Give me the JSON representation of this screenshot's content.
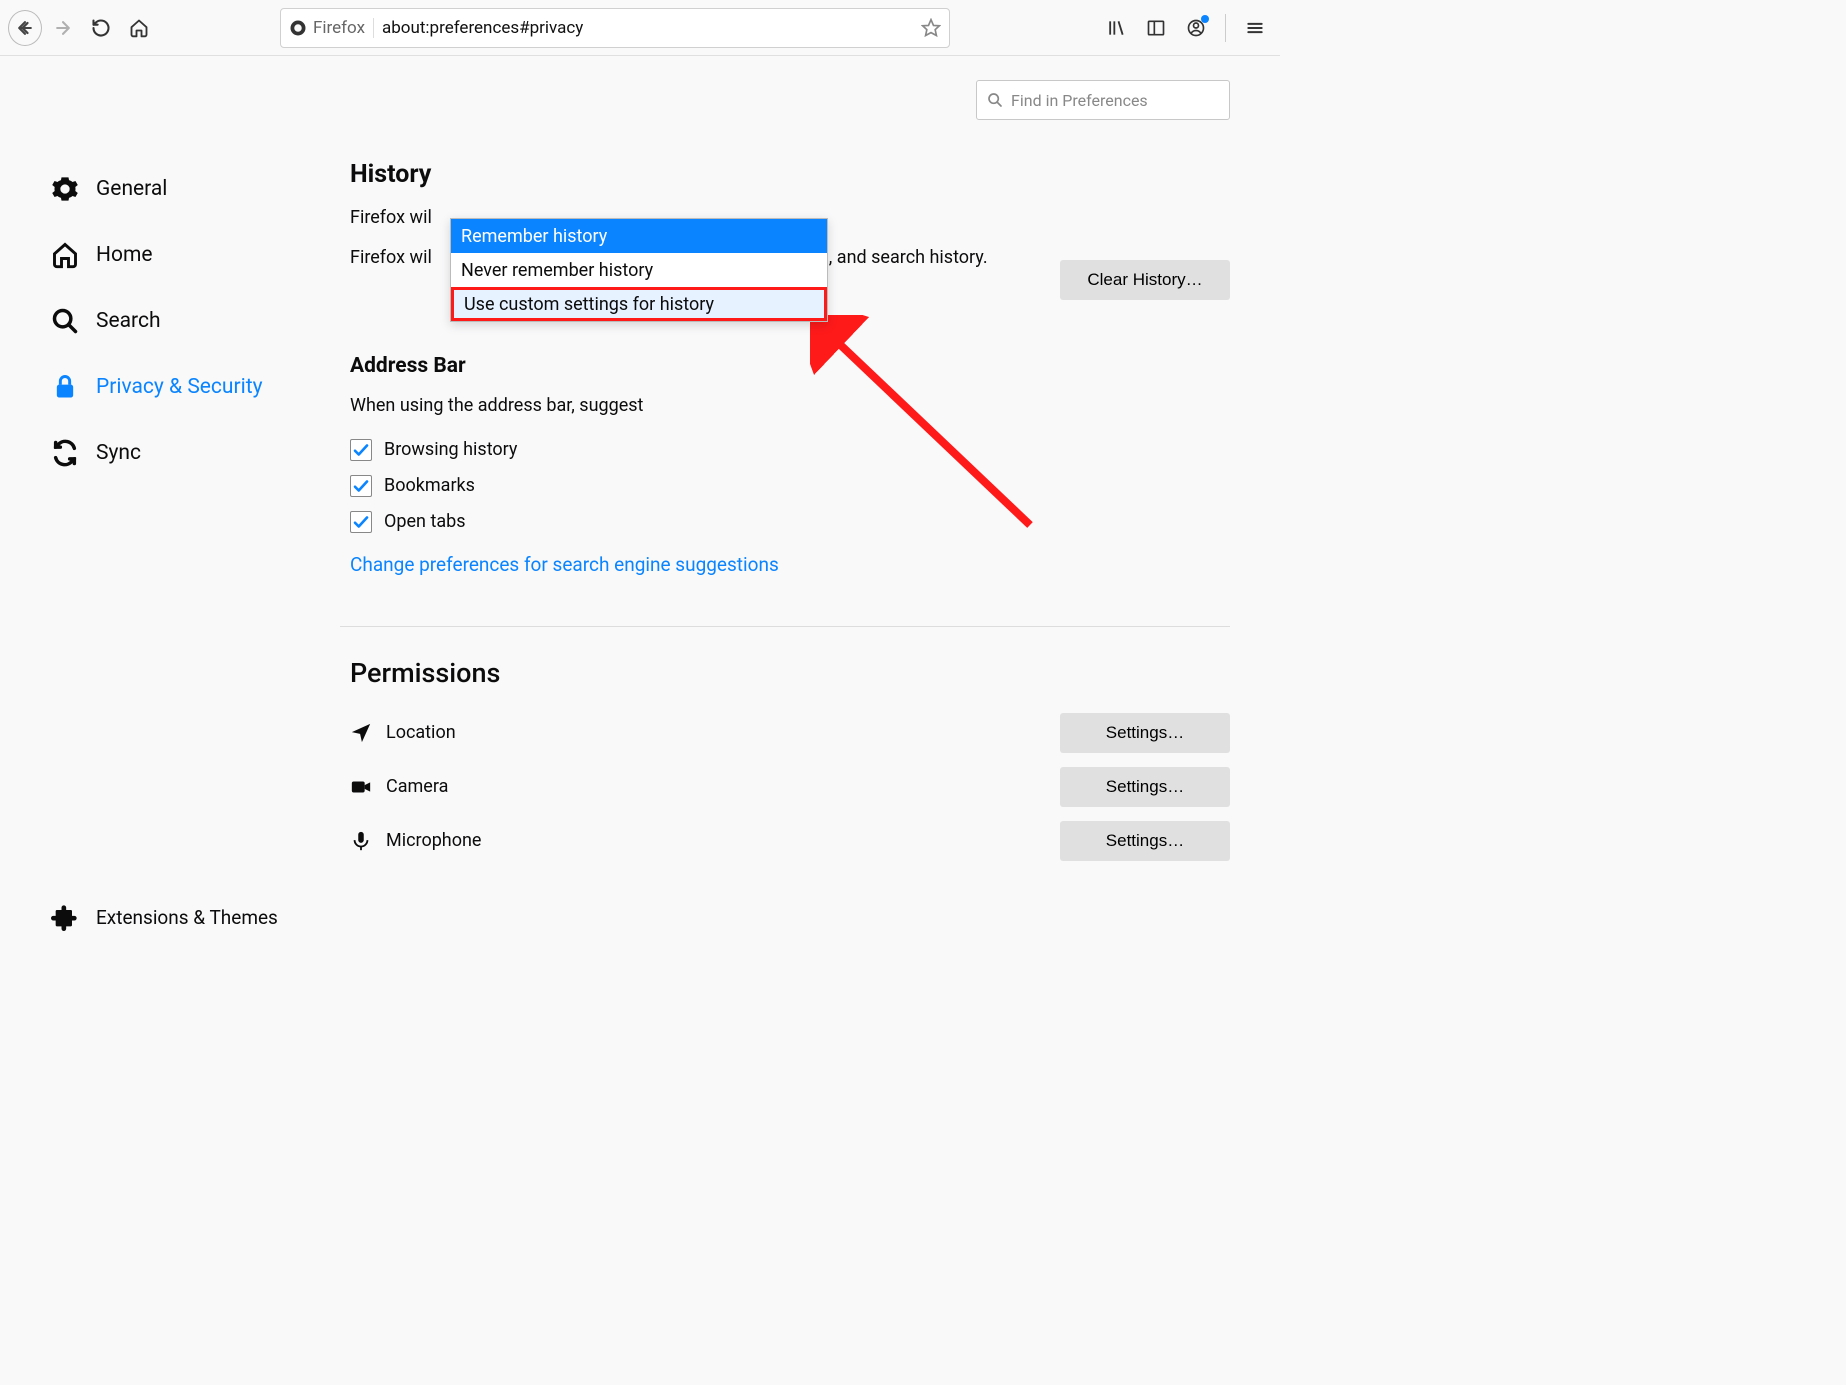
{
  "toolbar": {
    "identity_label": "Firefox",
    "url": "about:preferences#privacy"
  },
  "search": {
    "placeholder": "Find in Preferences"
  },
  "sidebar": {
    "items": [
      {
        "label": "General"
      },
      {
        "label": "Home"
      },
      {
        "label": "Search"
      },
      {
        "label": "Privacy & Security"
      },
      {
        "label": "Sync"
      }
    ],
    "footer": {
      "label": "Extensions & Themes"
    }
  },
  "history": {
    "heading": "History",
    "sentence_prefix": "Firefox wil",
    "desc_prefix": "Firefox wil",
    "desc_suffix": "rm, and search history.",
    "clear_button": "Clear History…",
    "dropdown": [
      "Remember history",
      "Never remember history",
      "Use custom settings for history"
    ]
  },
  "addressbar": {
    "heading": "Address Bar",
    "subtext": "When using the address bar, suggest",
    "options": [
      "Browsing history",
      "Bookmarks",
      "Open tabs"
    ],
    "link": "Change preferences for search engine suggestions"
  },
  "permissions": {
    "heading": "Permissions",
    "rows": [
      {
        "label": "Location",
        "button": "Settings…"
      },
      {
        "label": "Camera",
        "button": "Settings…"
      },
      {
        "label": "Microphone",
        "button": "Settings…"
      }
    ]
  }
}
